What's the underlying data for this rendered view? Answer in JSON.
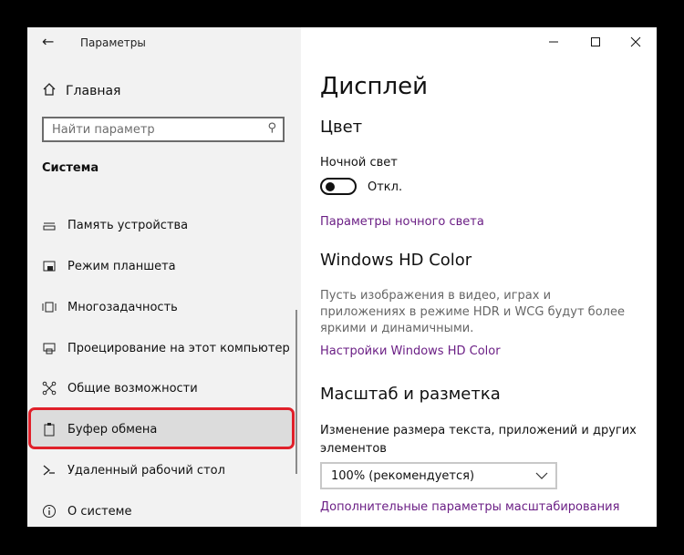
{
  "window": {
    "title": "Параметры",
    "controls": {
      "minimize": "—",
      "maximize": "☐",
      "close": "✕"
    }
  },
  "sidebar": {
    "home_label": "Главная",
    "search_placeholder": "Найти параметр",
    "section_title": "Система",
    "items": [
      {
        "label": "Память устройства",
        "icon": "storage-icon"
      },
      {
        "label": "Режим планшета",
        "icon": "tablet-icon"
      },
      {
        "label": "Многозадачность",
        "icon": "multitasking-icon"
      },
      {
        "label": "Проецирование на этот компьютер",
        "icon": "project-icon"
      },
      {
        "label": "Общие возможности",
        "icon": "shared-experiences-icon"
      },
      {
        "label": "Буфер обмена",
        "icon": "clipboard-icon",
        "highlighted": true
      },
      {
        "label": "Удаленный рабочий стол",
        "icon": "remote-desktop-icon"
      },
      {
        "label": "О системе",
        "icon": "info-icon"
      }
    ]
  },
  "main": {
    "page_title": "Дисплей",
    "color_section": "Цвет",
    "night_light_label": "Ночной свет",
    "night_light_state": "Откл.",
    "night_light_link": "Параметры ночного света",
    "hd_section": "Windows HD Color",
    "hd_description": "Пусть изображения в видео, играх и приложениях в режиме HDR и WCG будут более яркими и динамичными.",
    "hd_link": "Настройки Windows HD Color",
    "scale_section": "Масштаб и разметка",
    "scale_label": "Изменение размера текста, приложений и других элементов",
    "scale_value": "100% (рекомендуется)",
    "scale_link": "Дополнительные параметры масштабирования"
  },
  "colors": {
    "accent_link": "#6b1f85",
    "highlight_border": "#e0202a",
    "background": "#000000"
  }
}
